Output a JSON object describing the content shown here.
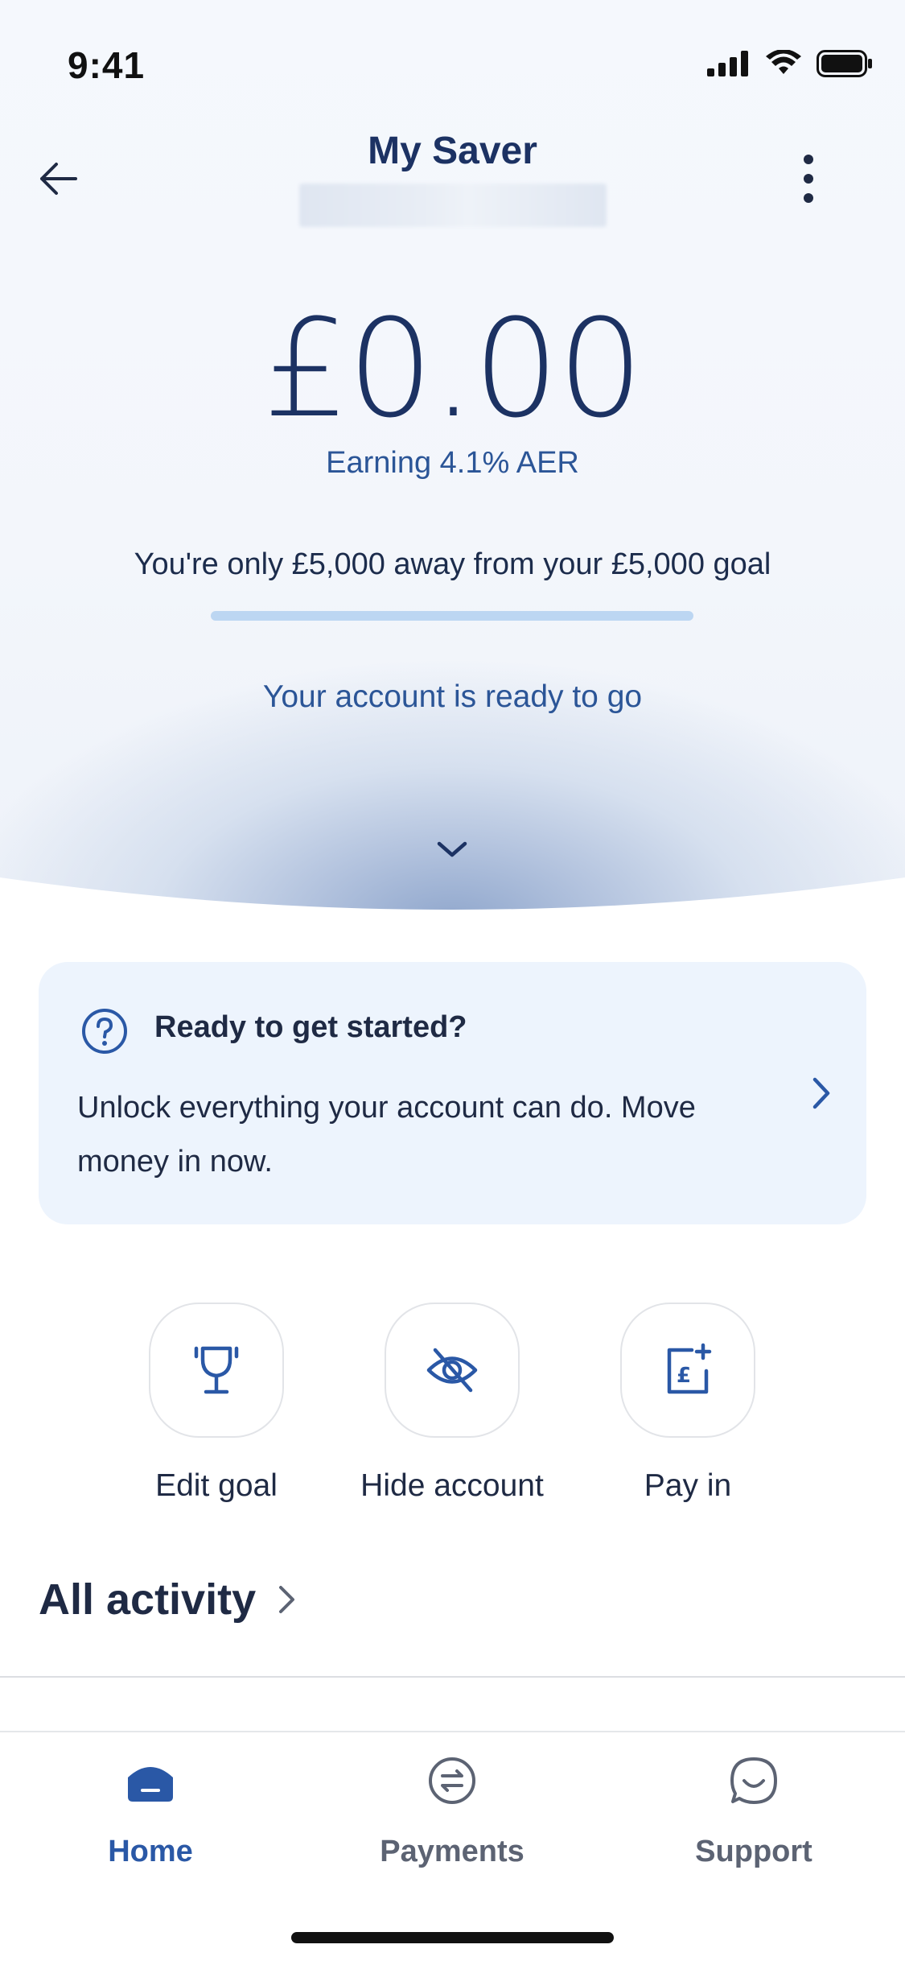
{
  "status_bar": {
    "time": "9:41"
  },
  "header": {
    "title": "My Saver"
  },
  "balance": {
    "amount": "£0.00",
    "earning": "Earning 4.1% AER"
  },
  "goal": {
    "text": "You're only £5,000 away from your £5,000 goal",
    "progress_percent": 0
  },
  "account_status": "Your account is ready to go",
  "prompt_card": {
    "title": "Ready to get started?",
    "body": "Unlock everything your account can do. Move money in now."
  },
  "actions": [
    {
      "label": "Edit goal",
      "icon": "trophy-icon"
    },
    {
      "label": "Hide account",
      "icon": "eye-off-icon"
    },
    {
      "label": "Pay in",
      "icon": "pay-in-pound-icon"
    }
  ],
  "activity": {
    "title": "All activity"
  },
  "tabs": [
    {
      "label": "Home",
      "icon": "home-icon",
      "active": true
    },
    {
      "label": "Payments",
      "icon": "payments-icon",
      "active": false
    },
    {
      "label": "Support",
      "icon": "support-chat-icon",
      "active": false
    }
  ],
  "colors": {
    "primary": "#2a58a6",
    "heading": "#1c3263",
    "card_bg": "#edf4fd",
    "progress_track": "#bcd6f2"
  }
}
